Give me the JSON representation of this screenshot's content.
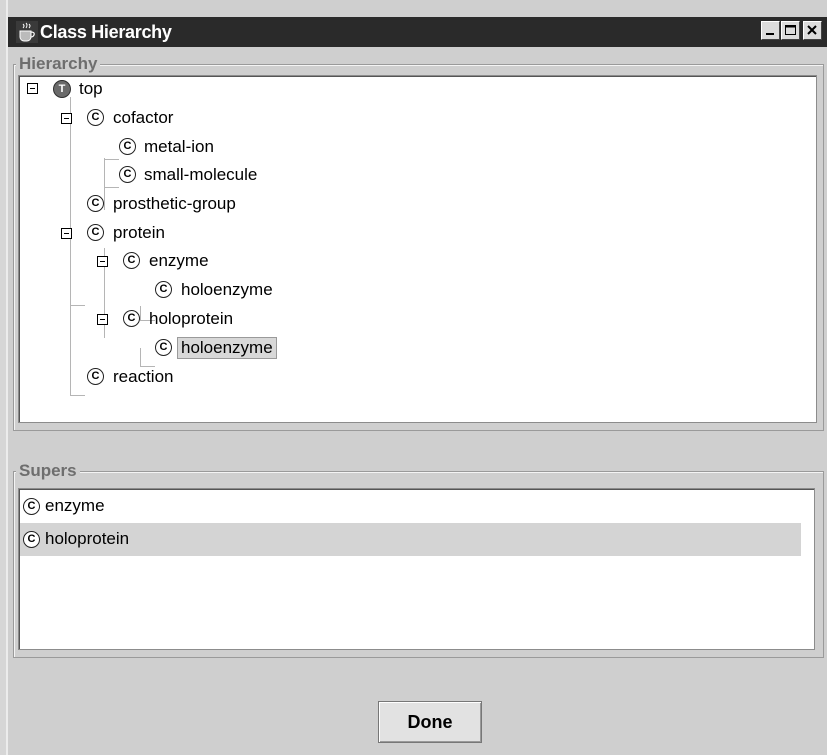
{
  "window": {
    "title": "Class Hierarchy"
  },
  "hierarchy": {
    "label": "Hierarchy",
    "root": {
      "label": "top",
      "icon": "T"
    },
    "nodes": [
      {
        "label": "cofactor",
        "icon": "C"
      },
      {
        "label": "metal-ion",
        "icon": "C"
      },
      {
        "label": "small-molecule",
        "icon": "C"
      },
      {
        "label": "prosthetic-group",
        "icon": "C"
      },
      {
        "label": "protein",
        "icon": "C"
      },
      {
        "label": "enzyme",
        "icon": "C"
      },
      {
        "label": "holoenzyme",
        "icon": "C"
      },
      {
        "label": "holoprotein",
        "icon": "C"
      },
      {
        "label": "holoenzyme",
        "icon": "C",
        "selected": true
      },
      {
        "label": "reaction",
        "icon": "C"
      }
    ]
  },
  "supers": {
    "label": "Supers",
    "items": [
      {
        "label": "enzyme",
        "icon": "C"
      },
      {
        "label": "holoprotein",
        "icon": "C",
        "selected": true
      }
    ]
  },
  "actions": {
    "done_label": "Done"
  },
  "icons": {
    "app": "java-cup-icon",
    "top_node": "thing-icon",
    "class_node": "class-icon",
    "minimize": "minimize-icon",
    "maximize": "maximize-icon",
    "close": "close-icon",
    "collapse": "collapse-icon"
  },
  "colors": {
    "titlebar": "#2a2a2a",
    "background": "#cfcfcf",
    "selection": "#d4d4d4"
  }
}
